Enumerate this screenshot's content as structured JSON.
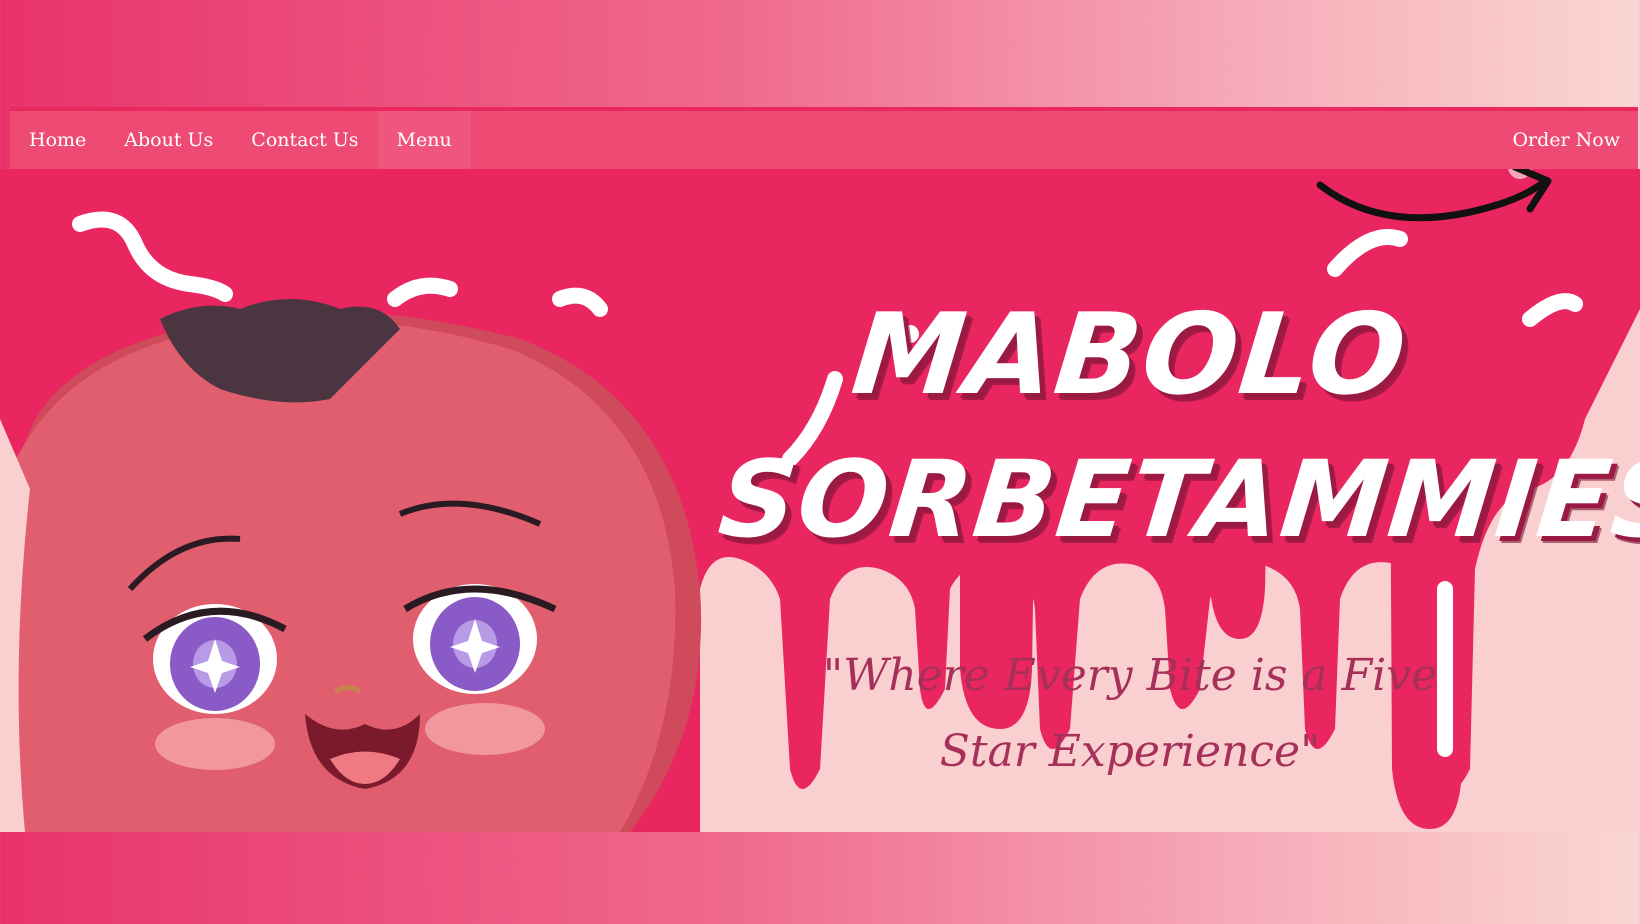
{
  "nav": {
    "items": [
      {
        "label": "Home"
      },
      {
        "label": "About Us"
      },
      {
        "label": "Contact Us"
      },
      {
        "label": "Menu"
      }
    ],
    "order_label": "Order Now"
  },
  "hero": {
    "title_line1": "MABOLO",
    "title_line2": "SORBETAMMIES",
    "tagline": "\"Where Every Bite is a Five Star Experience\"",
    "mascot": "mabolo-fruit-mascot",
    "arrow_icon": "curved-arrow-icon"
  },
  "colors": {
    "hero_bg": "#ea2660",
    "nav_bg": "#ee4b74",
    "drip_light": "#f9cfcf",
    "mascot_body": "#e05e6e",
    "tagline": "#a6305a"
  }
}
